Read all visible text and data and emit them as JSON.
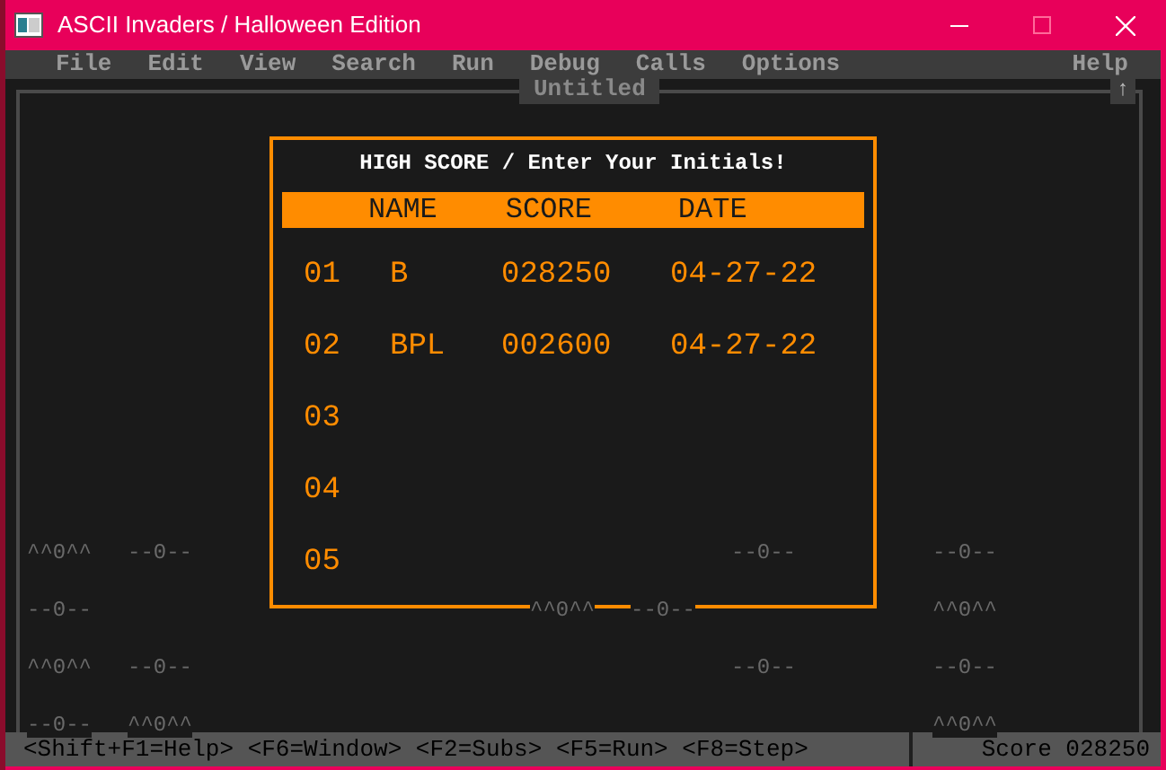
{
  "window": {
    "title": "ASCII Invaders / Halloween Edition"
  },
  "menu": {
    "items": [
      "File",
      "Edit",
      "View",
      "Search",
      "Run",
      "Debug",
      "Calls",
      "Options"
    ],
    "help": "Help"
  },
  "editor": {
    "title": "Untitled",
    "scroll_arrow": "↑"
  },
  "invaders": [
    [
      "^^0^^",
      "--0--",
      "--0--",
      "--0--"
    ],
    [
      "--0--",
      "^^0^^",
      "--0--",
      "^^0^^"
    ],
    [
      "^^0^^",
      "--0--",
      "--0--",
      "--0--"
    ],
    [
      "--0--",
      "^^0^^",
      "^^0^^"
    ]
  ],
  "dialog": {
    "title": "HIGH SCORE / Enter Your Initials!",
    "columns": [
      "NAME",
      "SCORE",
      "DATE"
    ],
    "rows": [
      {
        "rank": "01",
        "name": "B",
        "score": "028250",
        "date": "04-27-22"
      },
      {
        "rank": "02",
        "name": "BPL",
        "score": "002600",
        "date": "04-27-22"
      },
      {
        "rank": "03"
      },
      {
        "rank": "04"
      },
      {
        "rank": "05"
      }
    ]
  },
  "status_bar": {
    "keys": "<Shift+F1=Help> <F6=Window> <F2=Subs> <F5=Run> <F8=Step>",
    "score": "Score 028250"
  }
}
